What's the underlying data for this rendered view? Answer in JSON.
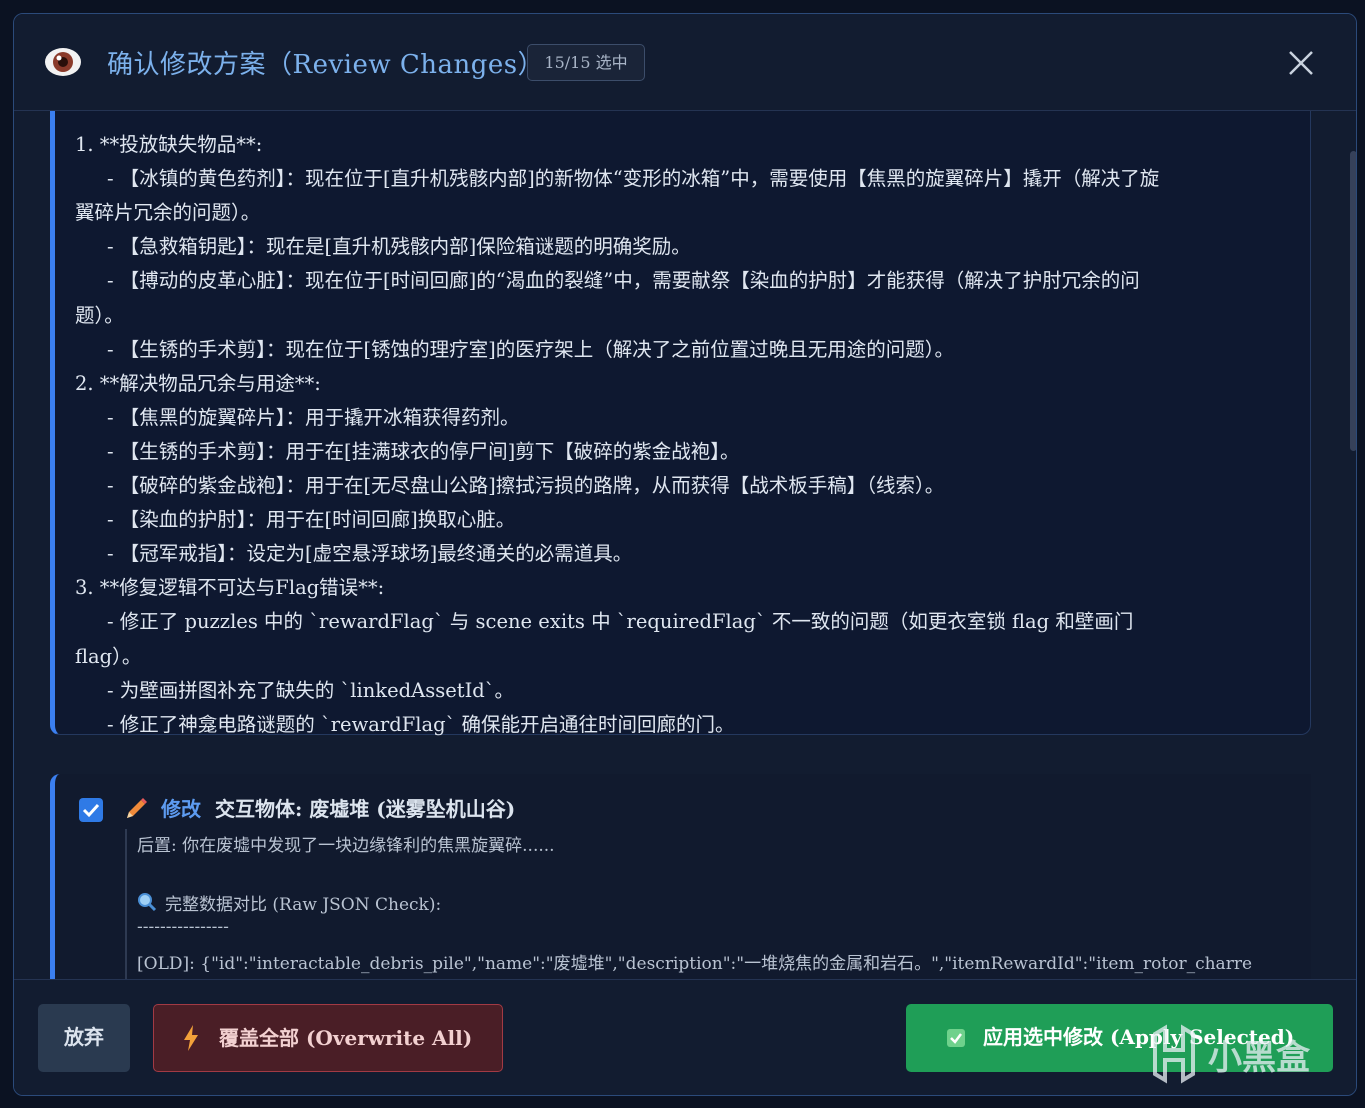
{
  "header": {
    "title": "确认修改方案（Review Changes）",
    "count_badge": "15/15 选中",
    "icons": {
      "left": "eye-icon",
      "close": "close-icon"
    }
  },
  "summary": {
    "lines": [
      {
        "text": "1. **投放缺失物品**:",
        "indent": false
      },
      {
        "text": "- 【冰镇的黄色药剂】：现在位于[直升机残骸内部]的新物体“变形的冰箱”中，需要使用【焦黑的旋翼碎片】撬开（解决了旋",
        "indent": true
      },
      {
        "text": "翼碎片冗余的问题）。",
        "indent": false
      },
      {
        "text": "- 【急救箱钥匙】：现在是[直升机残骸内部]保险箱谜题的明确奖励。",
        "indent": true
      },
      {
        "text": "- 【搏动的皮革心脏】：现在位于[时间回廊]的“渴血的裂缝”中，需要献祭【染血的护肘】才能获得（解决了护肘冗余的问",
        "indent": true
      },
      {
        "text": "题）。",
        "indent": false
      },
      {
        "text": "- 【生锈的手术剪】：现在位于[锈蚀的理疗室]的医疗架上（解决了之前位置过晚且无用途的问题）。",
        "indent": true
      },
      {
        "text": "2. **解决物品冗余与用途**:",
        "indent": false
      },
      {
        "text": "- 【焦黑的旋翼碎片】：用于撬开冰箱获得药剂。",
        "indent": true
      },
      {
        "text": "- 【生锈的手术剪】：用于在[挂满球衣的停尸间]剪下【破碎的紫金战袍】。",
        "indent": true
      },
      {
        "text": "- 【破碎的紫金战袍】：用于在[无尽盘山公路]擦拭污损的路牌，从而获得【战术板手稿】（线索）。",
        "indent": true
      },
      {
        "text": "- 【染血的护肘】：用于在[时间回廊]换取心脏。",
        "indent": true
      },
      {
        "text": "- 【冠军戒指】：设定为[虚空悬浮球场]最终通关的必需道具。",
        "indent": true
      },
      {
        "text": "3. **修复逻辑不可达与Flag错误**:",
        "indent": false
      },
      {
        "text": "- 修正了 puzzles 中的 `rewardFlag` 与 scene exits 中 `requiredFlag` 不一致的问题（如更衣室锁 flag 和壁画门",
        "indent": true
      },
      {
        "text": "flag）。",
        "indent": false
      },
      {
        "text": "- 为壁画拼图补充了缺失的 `linkedAssetId`。",
        "indent": true
      },
      {
        "text": "- 修正了神龛电路谜题的 `rewardFlag` 确保能开启通往时间回廊的门。",
        "indent": true
      }
    ]
  },
  "change": {
    "checked": true,
    "kind": "修改",
    "target": "交互物体: 废墟堆 (迷雾坠机山谷)",
    "after_label": "后置: 你在废墟中发现了一块边缘锋利的焦黑旋翼碎......",
    "raw_check_label": "完整数据对比 (Raw JSON Check):",
    "separator": "----------------",
    "old_line": "[OLD]: {\"id\":\"interactable_debris_pile\",\"name\":\"废墟堆\",\"description\":\"一堆烧焦的金属和岩石。\",\"itemRewardId\":\"item_rotor_charre"
  },
  "footer": {
    "discard_label": "放弃",
    "overwrite_label": "覆盖全部 (Overwrite All)",
    "apply_label": "应用选中修改 (Apply Selected)"
  },
  "watermark": {
    "text": "小黑盒"
  },
  "colors": {
    "accent": "#3b7ff0",
    "title": "#7cb1ec",
    "apply": "#1f9e57",
    "danger_border": "#a23a44",
    "background": "#121c30"
  }
}
